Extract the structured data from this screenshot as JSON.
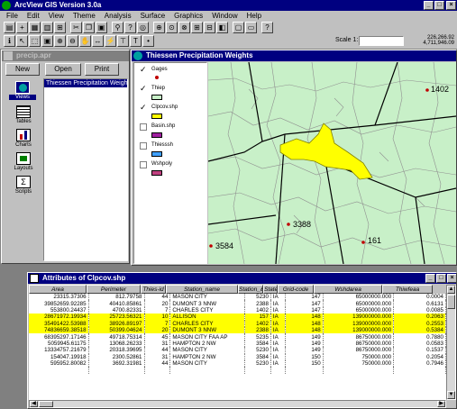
{
  "app": {
    "title": "ArcView GIS Version 3.0a",
    "menu": [
      "File",
      "Edit",
      "View",
      "Theme",
      "Analysis",
      "Surface",
      "Graphics",
      "Window",
      "Help"
    ],
    "scale_label": "Scale 1:",
    "scale_value": "",
    "coord_x": "226,266.92",
    "coord_y": "4,711,946.09"
  },
  "project": {
    "title": "precip.apr",
    "new_label": "New",
    "open_label": "Open",
    "print_label": "Print",
    "categories": [
      "Views",
      "Tables",
      "Charts",
      "Layouts",
      "Scripts"
    ],
    "views": [
      "Thiessen Precipitation Weights"
    ]
  },
  "view": {
    "title": "Thiessen Precipitation Weights",
    "themes": [
      {
        "name": "Gages",
        "checked": true
      },
      {
        "name": "Thiep",
        "checked": true
      },
      {
        "name": "Clpcov.shp",
        "checked": true
      },
      {
        "name": "Basin.shp",
        "checked": false
      },
      {
        "name": "Thiesssh",
        "checked": false
      },
      {
        "name": "Wshpoly",
        "checked": false
      }
    ],
    "map_labels": [
      "1402",
      "3388",
      "3584",
      "161"
    ]
  },
  "table": {
    "title": "Attributes of Clpcov.shp",
    "columns": [
      "Area",
      "Perimeter",
      "Thies-id",
      "Station_name",
      "Station_&",
      "State",
      "Grid-code",
      "Wshdarea",
      "Thiwfeaa"
    ],
    "rows": [
      {
        "hl": false,
        "cells": [
          "23315.37306",
          "812.79758",
          "44",
          "MASON CITY",
          "5230",
          "IA",
          "147",
          "65000000.000",
          "0.0004"
        ]
      },
      {
        "hl": false,
        "cells": [
          "39852659.92285",
          "40410.85861",
          "20",
          "DUMONT 3 NNW",
          "2388",
          "IA",
          "147",
          "65000000.000",
          "0.6131"
        ]
      },
      {
        "hl": false,
        "cells": [
          "553800.24437",
          "4700.82331",
          "7",
          "CHARLES CITY",
          "1402",
          "IA",
          "147",
          "65000000.000",
          "0.0085"
        ]
      },
      {
        "hl": true,
        "cells": [
          "28671972.19934",
          "25723.56321",
          "10",
          "ALLISON",
          "157",
          "IA",
          "148",
          "139000000.000",
          "0.2063"
        ]
      },
      {
        "hl": true,
        "cells": [
          "35491422.53988",
          "38926.89197",
          "7",
          "CHARLES CITY",
          "1402",
          "IA",
          "148",
          "139000000.000",
          "0.2553"
        ]
      },
      {
        "hl": true,
        "cells": [
          "74836659.38518",
          "50399.04624",
          "20",
          "DUMONT 3 NNW",
          "2388",
          "IA",
          "148",
          "139000000.000",
          "0.5384"
        ]
      },
      {
        "hl": false,
        "cells": [
          "68395297.17146",
          "49718.75314",
          "45",
          "MASON CITY FAA AP",
          "5235",
          "IA",
          "149",
          "86750000.000",
          "0.7880"
        ]
      },
      {
        "hl": false,
        "cells": [
          "5059945.61175",
          "13068.26233",
          "31",
          "HAMPTON 2 NW",
          "3584",
          "IA",
          "149",
          "86750000.000",
          "0.0583"
        ]
      },
      {
        "hl": false,
        "cells": [
          "13334757.21679",
          "20318.39695",
          "44",
          "MASON CITY",
          "5230",
          "IA",
          "149",
          "86750000.000",
          "0.1537"
        ]
      },
      {
        "hl": false,
        "cells": [
          "154047.19918",
          "2300.52861",
          "31",
          "HAMPTON 2 NW",
          "3584",
          "IA",
          "150",
          "750000.000",
          "0.2054"
        ]
      },
      {
        "hl": false,
        "cells": [
          "595952.80082",
          "3692.31981",
          "44",
          "MASON CITY",
          "5230",
          "IA",
          "150",
          "750000.000",
          "0.7946"
        ]
      },
      {
        "hl": false,
        "cells": [
          "",
          "",
          "",
          "",
          "",
          "",
          "",
          "",
          ""
        ]
      }
    ]
  }
}
